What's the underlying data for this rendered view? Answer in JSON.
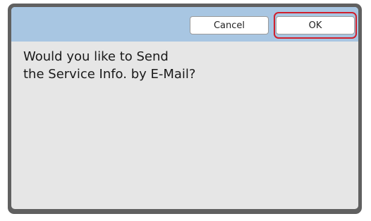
{
  "dialog": {
    "cancel_label": "Cancel",
    "ok_label": "OK",
    "message_line1": "Would you like to Send",
    "message_line2": "the Service Info. by E-Mail?"
  },
  "colors": {
    "header_bar": "#a8c6e2",
    "body_bg": "#e6e6e6",
    "frame": "#606060",
    "highlight": "#d0202c"
  }
}
